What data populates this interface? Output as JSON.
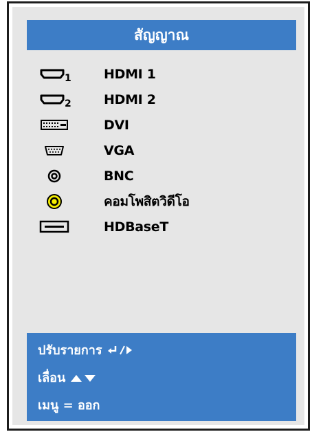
{
  "header": {
    "title": "สัญญาณ"
  },
  "sources": [
    {
      "label": "HDMI 1",
      "icon": "hdmi-1-port-icon",
      "subscript": "1"
    },
    {
      "label": "HDMI 2",
      "icon": "hdmi-2-port-icon",
      "subscript": "2"
    },
    {
      "label": "DVI",
      "icon": "dvi-port-icon"
    },
    {
      "label": "VGA",
      "icon": "vga-port-icon"
    },
    {
      "label": "BNC",
      "icon": "bnc-port-icon"
    },
    {
      "label": "คอมโพสิตวิดีโอ",
      "icon": "composite-video-port-icon"
    },
    {
      "label": "HDBaseT",
      "icon": "hdbaset-port-icon"
    }
  ],
  "footer": {
    "adjust_label": "ปรับรายการ",
    "move_label": "เลื่อน",
    "menu_label": "เมนู = ออก"
  },
  "colors": {
    "panel_blue": "#3d7dc6",
    "panel_bg": "#e6e6e6",
    "composite_yellow": "#f5ee00"
  }
}
